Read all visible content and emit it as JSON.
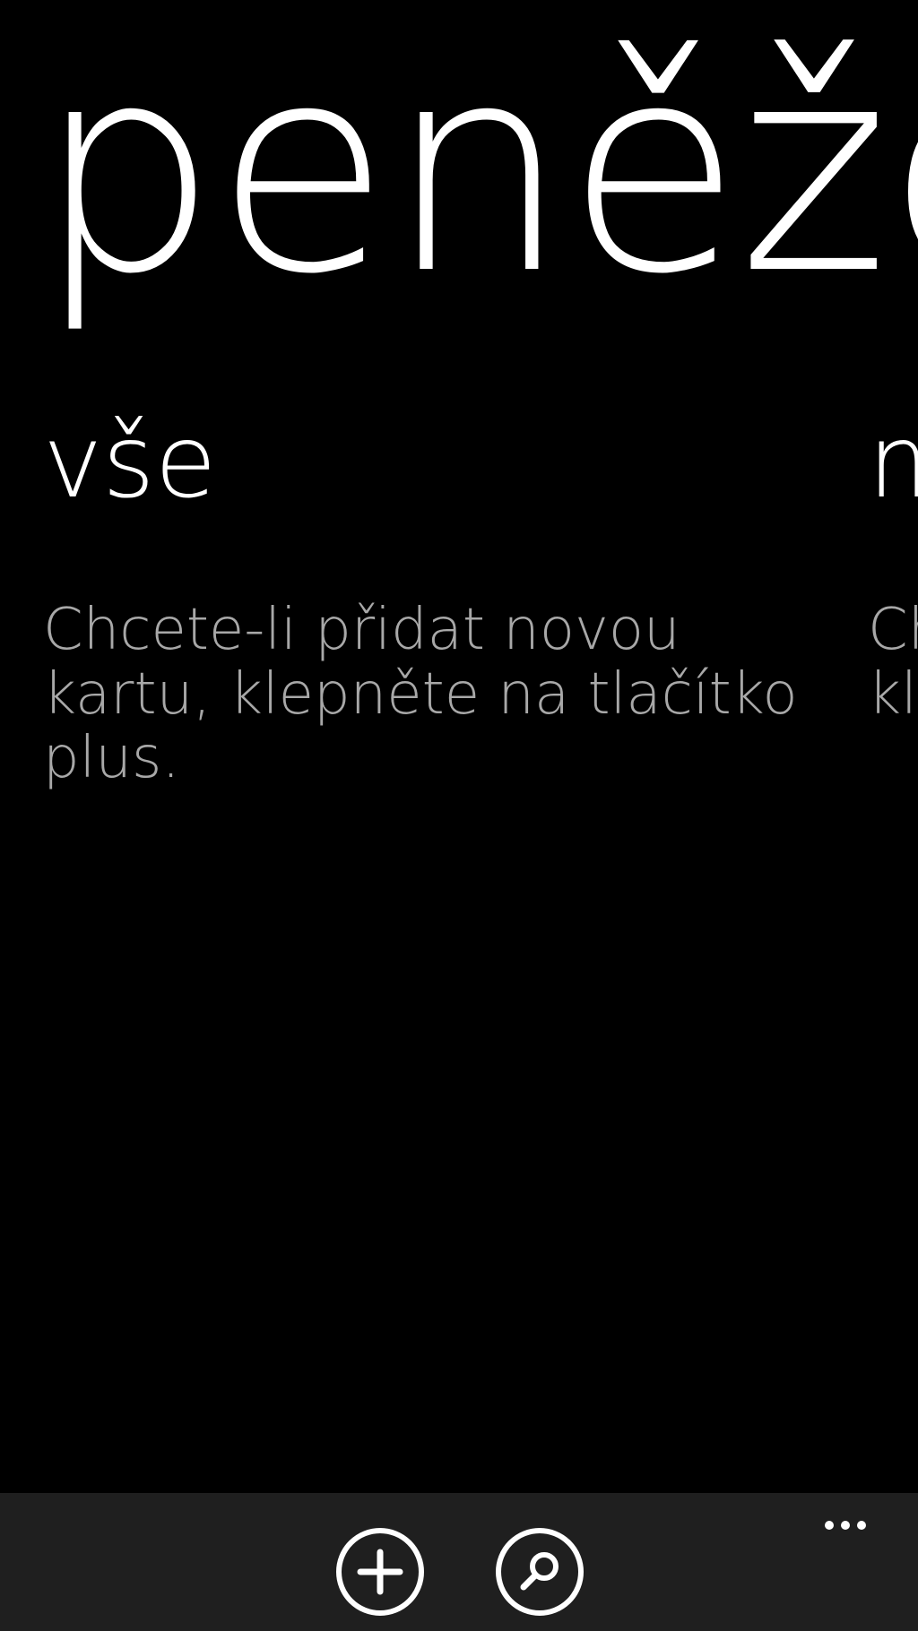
{
  "app": {
    "title": "peněženka"
  },
  "pivot": {
    "items": [
      {
        "label": "vše",
        "message": "Chcete-li přidat novou kartu, klepněte na tlačítko plus."
      },
      {
        "label": "místní",
        "message": "Chcete-li najít nabídky, klepněte na hledání."
      }
    ]
  },
  "app_bar": {
    "buttons": [
      {
        "icon": "add-icon"
      },
      {
        "icon": "search-icon"
      }
    ],
    "more": {
      "icon": "ellipsis-icon"
    }
  },
  "colors": {
    "background": "#000000",
    "foreground": "#ffffff",
    "subtle_text": "#a8a8a8",
    "app_bar": "#1f1f1f"
  }
}
